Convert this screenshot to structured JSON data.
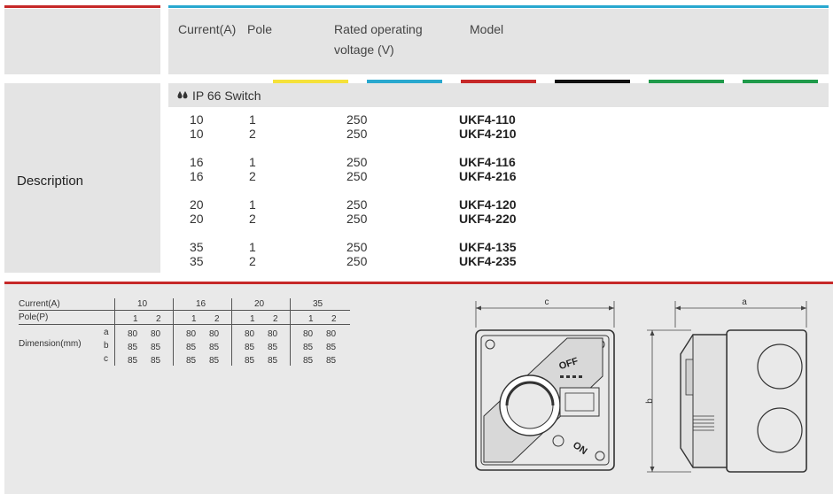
{
  "top_table": {
    "headers": {
      "current": "Current(A)",
      "pole": "Pole",
      "voltage_line1": "Rated operating",
      "voltage_line2": "voltage (V)",
      "model": "Model"
    },
    "swatch_colors": [
      "#f5e13a",
      "#29a8cf",
      "#c62828",
      "#111111",
      "#1f9a4a",
      "#1f9a4a"
    ],
    "description_label": "Description",
    "section_title": "IP 66 Switch",
    "section_icon": "water-drops-icon",
    "rows": [
      {
        "current": "10",
        "pole": "1",
        "voltage": "250",
        "model": "UKF4-110"
      },
      {
        "current": "10",
        "pole": "2",
        "voltage": "250",
        "model": "UKF4-210"
      },
      {
        "current": "16",
        "pole": "1",
        "voltage": "250",
        "model": "UKF4-116"
      },
      {
        "current": "16",
        "pole": "2",
        "voltage": "250",
        "model": "UKF4-216"
      },
      {
        "current": "20",
        "pole": "1",
        "voltage": "250",
        "model": "UKF4-120"
      },
      {
        "current": "20",
        "pole": "2",
        "voltage": "250",
        "model": "UKF4-220"
      },
      {
        "current": "35",
        "pole": "1",
        "voltage": "250",
        "model": "UKF4-135"
      },
      {
        "current": "35",
        "pole": "2",
        "voltage": "250",
        "model": "UKF4-235"
      }
    ]
  },
  "dimension_table": {
    "row_labels": {
      "current": "Current(A)",
      "pole": "Pole(P)",
      "dimension": "Dimension(mm)"
    },
    "dim_letters": [
      "a",
      "b",
      "c"
    ],
    "groups": [
      {
        "current": "10",
        "poles": [
          "1",
          "2"
        ],
        "a": [
          "80",
          "80"
        ],
        "b": [
          "85",
          "85"
        ],
        "c": [
          "85",
          "85"
        ]
      },
      {
        "current": "16",
        "poles": [
          "1",
          "2"
        ],
        "a": [
          "80",
          "80"
        ],
        "b": [
          "85",
          "85"
        ],
        "c": [
          "85",
          "85"
        ]
      },
      {
        "current": "20",
        "poles": [
          "1",
          "2"
        ],
        "a": [
          "80",
          "80"
        ],
        "b": [
          "85",
          "85"
        ],
        "c": [
          "85",
          "85"
        ]
      },
      {
        "current": "35",
        "poles": [
          "1",
          "2"
        ],
        "a": [
          "80",
          "80"
        ],
        "b": [
          "85",
          "85"
        ],
        "c": [
          "85",
          "85"
        ]
      }
    ]
  },
  "drawings": {
    "front_dim_label": "c",
    "side_width_label": "a",
    "side_height_label": "b",
    "off_label": "OFF",
    "on_label": "ON"
  },
  "colors": {
    "accent_red": "#c62828",
    "accent_blue": "#29a8cf",
    "panel_gray": "#e4e4e4"
  }
}
